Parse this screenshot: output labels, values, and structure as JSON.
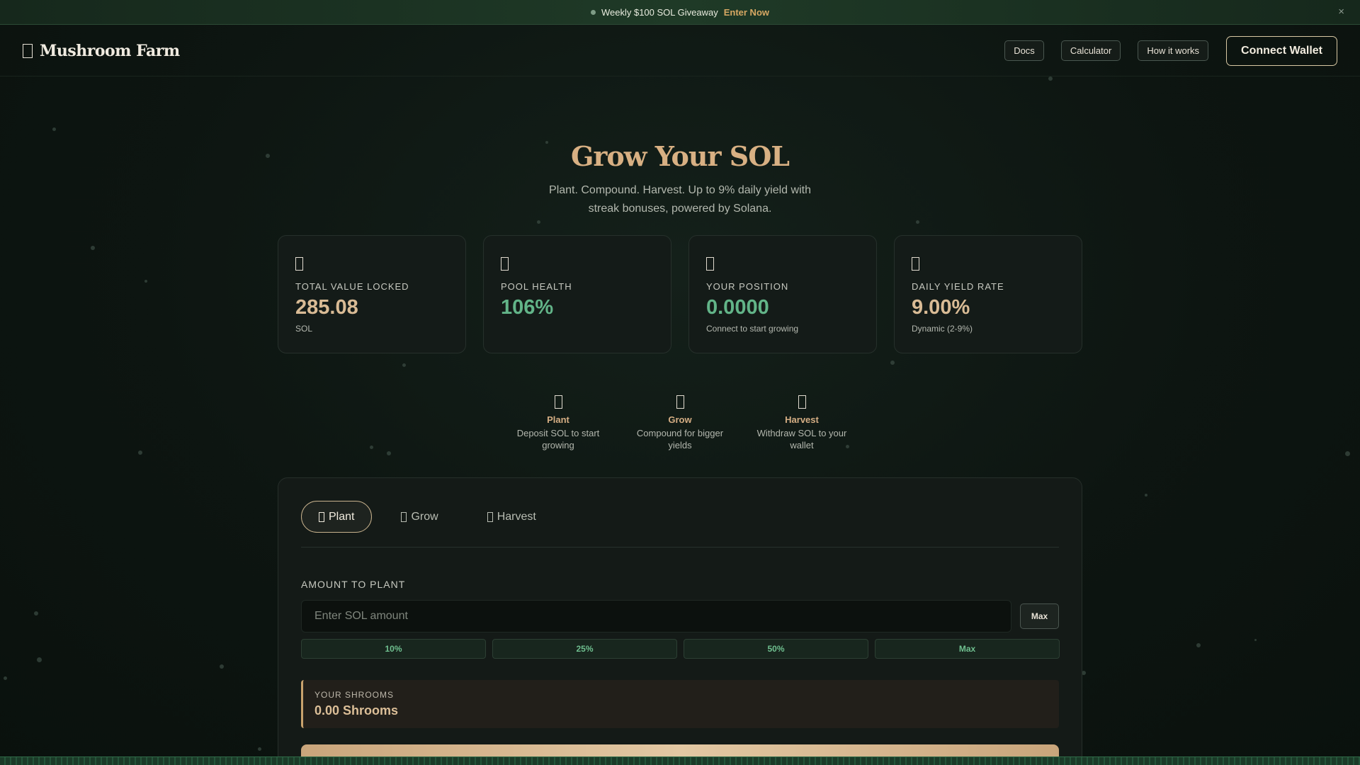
{
  "banner": {
    "text": "Weekly $100 SOL Giveaway",
    "cta": "Enter Now",
    "close": "×"
  },
  "header": {
    "logo_text": "Mushroom Farm",
    "nav": {
      "docs": "Docs",
      "calculator": "Calculator",
      "how_it_works": "How it works"
    },
    "connect_wallet": "Connect Wallet"
  },
  "hero": {
    "title": "Grow Your SOL",
    "subtitle": "Plant. Compound. Harvest. Up to 9% daily yield with streak bonuses, powered by Solana."
  },
  "stats": [
    {
      "label": "TOTAL VALUE LOCKED",
      "value": "285.08",
      "sub": "SOL"
    },
    {
      "label": "POOL HEALTH",
      "value": "106%",
      "sub": ""
    },
    {
      "label": "YOUR POSITION",
      "value": "0.0000",
      "sub": "Connect to start growing"
    },
    {
      "label": "DAILY YIELD RATE",
      "value": "9.00%",
      "sub": "Dynamic (2-9%)"
    }
  ],
  "steps": [
    {
      "title": "Plant",
      "desc": "Deposit SOL to start growing"
    },
    {
      "title": "Grow",
      "desc": "Compound for bigger yields"
    },
    {
      "title": "Harvest",
      "desc": "Withdraw SOL to your wallet"
    }
  ],
  "card": {
    "tabs": [
      {
        "label": "Plant"
      },
      {
        "label": "Grow"
      },
      {
        "label": "Harvest"
      }
    ],
    "amount_label": "AMOUNT TO PLANT",
    "input_placeholder": "Enter SOL amount",
    "max_label": "Max",
    "percent_buttons": [
      "10%",
      "25%",
      "50%",
      "Max"
    ],
    "shrooms_label": "YOUR SHROOMS",
    "shrooms_value": "0.00 Shrooms"
  },
  "colors": {
    "accent_gold": "#d8b083",
    "accent_green": "#62b488",
    "background": "#0d1511"
  },
  "icons": {
    "logo": "mushroom-icon",
    "stats": [
      "lock-icon",
      "heart-icon",
      "user-icon",
      "chart-icon"
    ],
    "steps": [
      "seed-icon",
      "sprout-icon",
      "basket-icon"
    ]
  }
}
